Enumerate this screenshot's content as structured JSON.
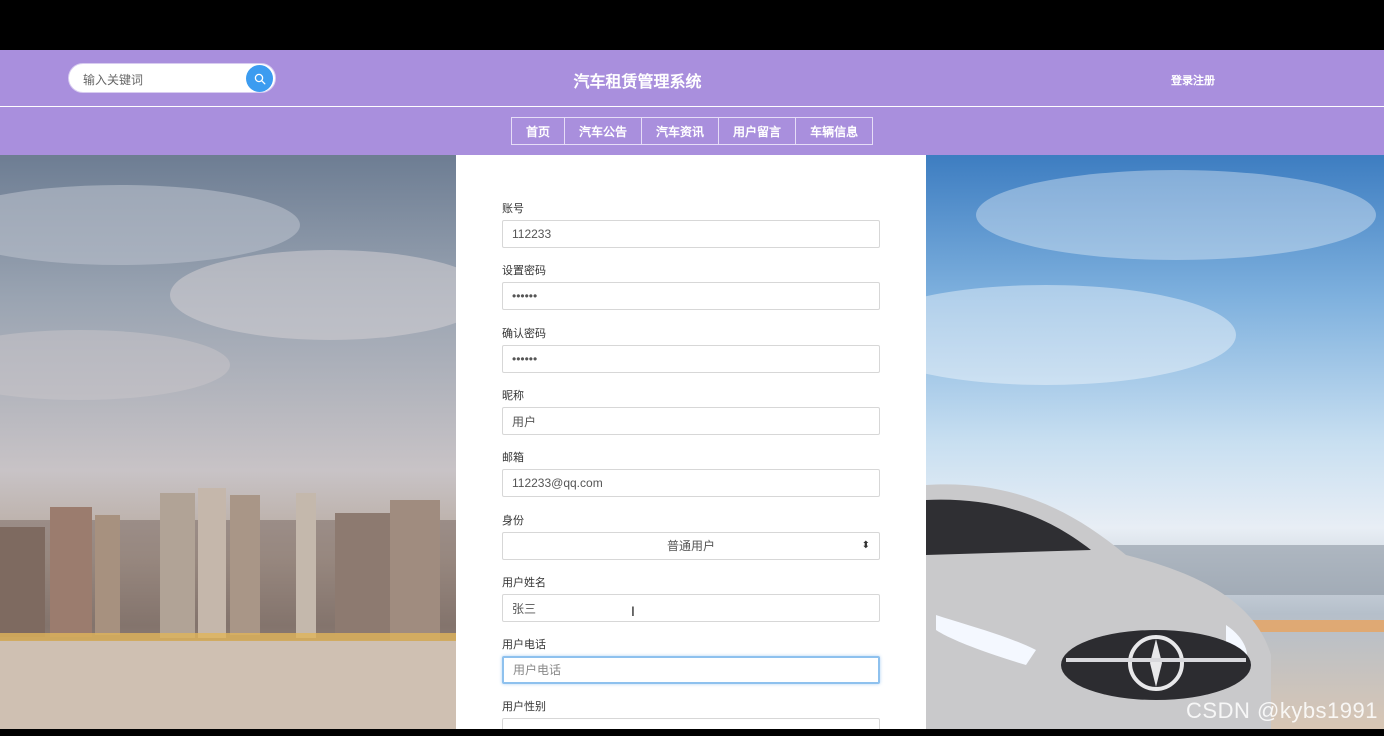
{
  "header": {
    "search_placeholder": "输入关键词",
    "site_title": "汽车租赁管理系统",
    "login_register": "登录注册"
  },
  "nav": {
    "items": [
      "首页",
      "汽车公告",
      "汽车资讯",
      "用户留言",
      "车辆信息"
    ]
  },
  "form": {
    "fields": [
      {
        "label": "账号",
        "value": "112233",
        "placeholder": ""
      },
      {
        "label": "设置密码",
        "value": "••••••",
        "placeholder": ""
      },
      {
        "label": "确认密码",
        "value": "••••••",
        "placeholder": ""
      },
      {
        "label": "昵称",
        "value": "用户",
        "placeholder": ""
      },
      {
        "label": "邮箱",
        "value": "112233@qq.com",
        "placeholder": ""
      },
      {
        "label": "身份",
        "value": "普通用户",
        "placeholder": ""
      },
      {
        "label": "用户姓名",
        "value": "张三",
        "placeholder": ""
      },
      {
        "label": "用户电话",
        "value": "",
        "placeholder": "用户电话"
      },
      {
        "label": "用户性别",
        "value": "",
        "placeholder": ""
      }
    ]
  },
  "watermark": "CSDN @kybs1991",
  "colors": {
    "header_bg": "#a98fdd",
    "search_button": "#3c9cf0",
    "focus_border": "#8ec1ee"
  },
  "icons": {
    "search": "search-icon",
    "select_arrow": "sort-arrows-icon"
  }
}
